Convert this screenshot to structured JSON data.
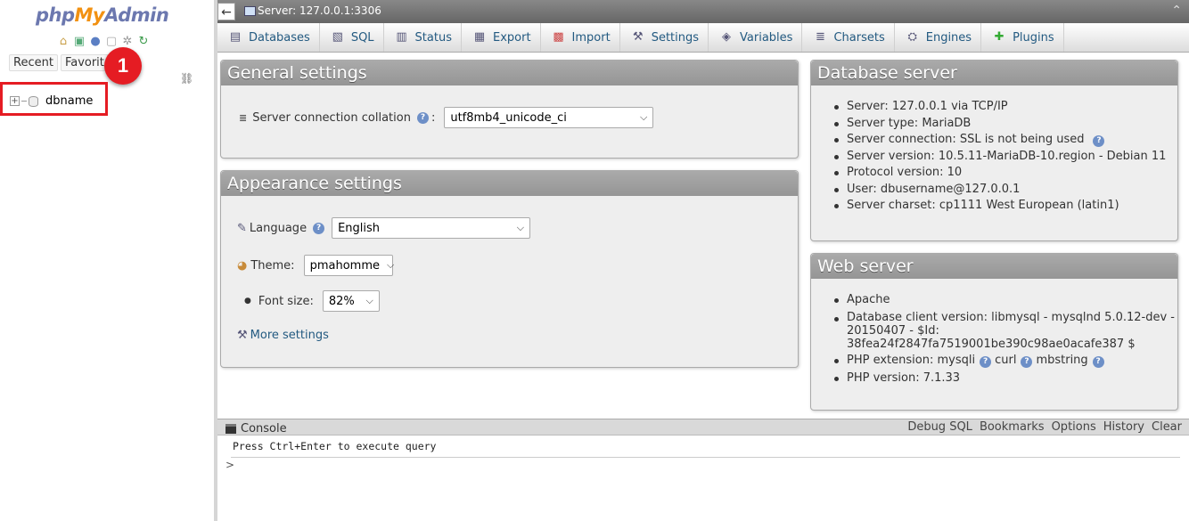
{
  "logo": {
    "part1": "php",
    "part2": "My",
    "part3": "Admin"
  },
  "nav": {
    "icons": [
      "home-icon",
      "logout-icon",
      "help-icon",
      "docs-icon",
      "settings-icon",
      "reload-icon"
    ],
    "recent_label": "Recent",
    "favorites_label": "Favorite",
    "badge_number": "1",
    "databases": [
      {
        "name": "dbname"
      }
    ]
  },
  "topbar": {
    "back_glyph": "←",
    "server_label": "Server: 127.0.0.1:3306",
    "collapse_glyph": "⌃"
  },
  "tabs": [
    {
      "label": "Databases",
      "icon": "database-icon"
    },
    {
      "label": "SQL",
      "icon": "sql-icon"
    },
    {
      "label": "Status",
      "icon": "status-icon"
    },
    {
      "label": "Export",
      "icon": "export-icon"
    },
    {
      "label": "Import",
      "icon": "import-icon"
    },
    {
      "label": "Settings",
      "icon": "wrench-icon"
    },
    {
      "label": "Variables",
      "icon": "variables-icon"
    },
    {
      "label": "Charsets",
      "icon": "charsets-icon"
    },
    {
      "label": "Engines",
      "icon": "engines-icon"
    },
    {
      "label": "Plugins",
      "icon": "plugins-icon"
    }
  ],
  "general": {
    "title": "General settings",
    "collation_label": "Server connection collation",
    "collation_value": "utf8mb4_unicode_ci"
  },
  "appearance": {
    "title": "Appearance settings",
    "language_label": "Language",
    "language_value": "English",
    "theme_label": "Theme:",
    "theme_value": "pmahomme",
    "fontsize_label": "Font size:",
    "fontsize_value": "82%",
    "more_settings": "More settings"
  },
  "dbserver": {
    "title": "Database server",
    "items": [
      "Server: 127.0.0.1 via TCP/IP",
      "Server type: MariaDB",
      "Server connection: SSL is not being used",
      "Server version: 10.5.11-MariaDB-10.region - Debian 11",
      "Protocol version: 10",
      "User: dbusername@127.0.0.1",
      "Server charset: cp1111 West European (latin1)"
    ]
  },
  "webserver": {
    "title": "Web server",
    "apache": "Apache",
    "client_line1": "Database client version: libmysql - mysqlnd 5.0.12-dev -",
    "client_line2": "20150407 - $Id:",
    "client_line3": "38fea24f2847fa7519001be390c98ae0acafe387 $",
    "php_ext_label": "PHP extension: mysqli",
    "php_ext_curl": "curl",
    "php_ext_mbstring": "mbstring",
    "php_version": "PHP version: 7.1.33"
  },
  "console": {
    "label": "Console",
    "options": [
      "Debug SQL",
      "Bookmarks",
      "Options",
      "History",
      "Clear"
    ],
    "hint": "Press Ctrl+Enter to execute query",
    "prompt": ">"
  }
}
